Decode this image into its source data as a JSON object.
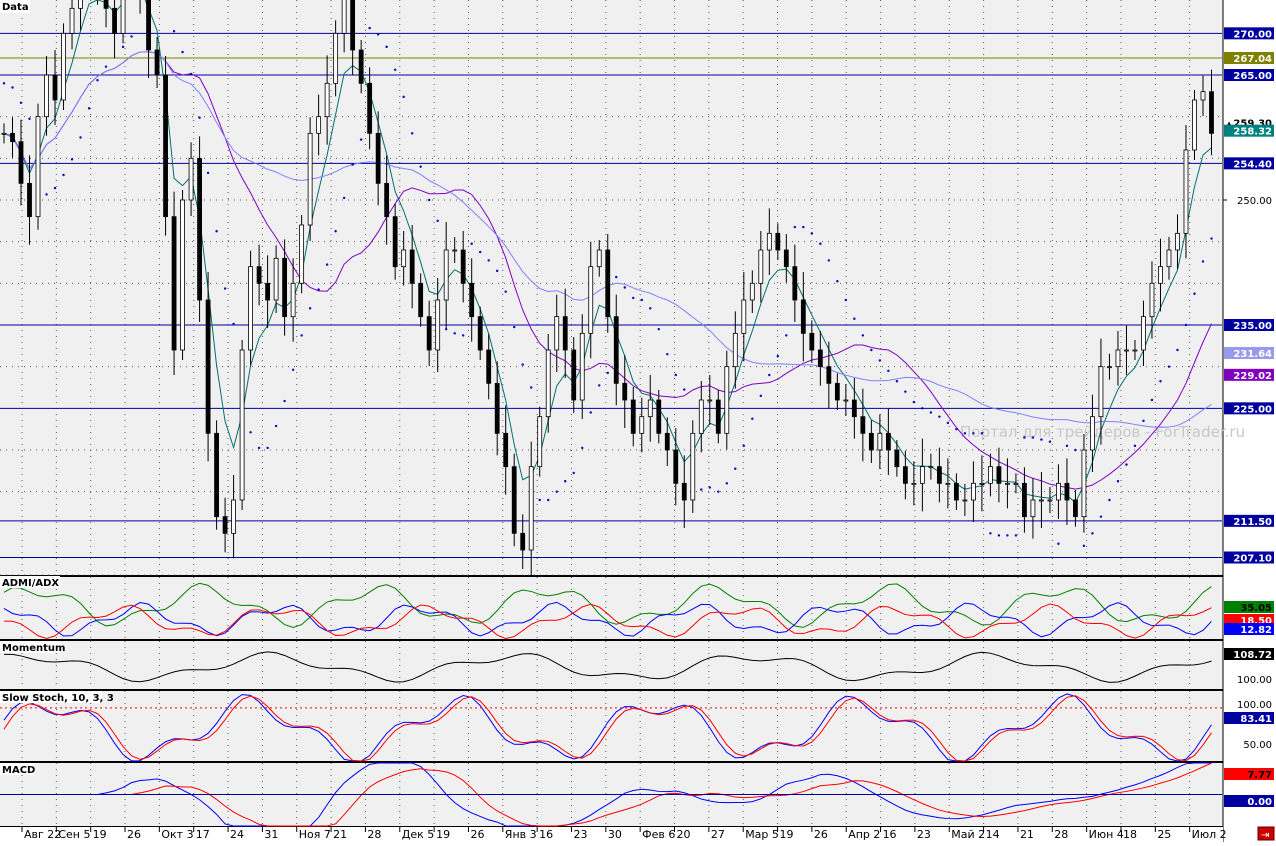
{
  "chart_data": [
    {
      "type": "candlestick",
      "panel": "Data",
      "title": "Data",
      "watermark": "Портал для трейдеров - ForTrader.ru",
      "ylim": [
        205,
        274
      ],
      "x_tick_labels": [
        "Авг 22",
        "Сен 5",
        "19",
        "26",
        "Окт 3",
        "17",
        "24",
        "31",
        "Ноя 7",
        "21",
        "28",
        "Дек 5",
        "19",
        "26",
        "Янв 3",
        "16",
        "23",
        "30",
        "Фев 6",
        "20",
        "27",
        "Мар 5",
        "19",
        "26",
        "Апр 2",
        "16",
        "23",
        "Май 2",
        "14",
        "21",
        "28",
        "Июн 4",
        "18",
        "25",
        "Июл 2"
      ],
      "y_ticks": [
        250
      ],
      "horizontal_lines": [
        {
          "value": 270.0,
          "label": "270.00",
          "color": "#0000a0"
        },
        {
          "value": 267.04,
          "label": "267.04",
          "color": "#808000"
        },
        {
          "value": 265.0,
          "label": "265.00",
          "color": "#0000a0"
        },
        {
          "value": 254.4,
          "label": "254.40",
          "color": "#0000a0"
        },
        {
          "value": 235.0,
          "label": "235.00",
          "color": "#0000a0"
        },
        {
          "value": 225.0,
          "label": "225.00",
          "color": "#0000a0"
        },
        {
          "value": 211.5,
          "label": "211.50",
          "color": "#0000a0"
        },
        {
          "value": 207.1,
          "label": "207.10",
          "color": "#0000a0"
        }
      ],
      "price_labels": [
        {
          "value": 259.3,
          "label": "259.30",
          "bg": "#ffffff",
          "fg": "#000000",
          "marker": "▲"
        },
        {
          "value": 258.32,
          "label": "258.32",
          "bg": "#008080",
          "fg": "#ffffff"
        },
        {
          "value": 231.64,
          "label": "231.64",
          "bg": "#9999ee",
          "fg": "#ffffff"
        },
        {
          "value": 229.02,
          "label": "229.02",
          "bg": "#8000c0",
          "fg": "#ffffff"
        }
      ],
      "closes": [
        258,
        257,
        252,
        248,
        260,
        265,
        262,
        270,
        273,
        278,
        280,
        275,
        273,
        270,
        276,
        280,
        275,
        268,
        265,
        248,
        232,
        250,
        255,
        238,
        222,
        212,
        210,
        214,
        232,
        242,
        240,
        238,
        243,
        236,
        240,
        247,
        258,
        260,
        264,
        270,
        275,
        268,
        264,
        258,
        252,
        248,
        242,
        244,
        240,
        236,
        232,
        238,
        244,
        244,
        240,
        236,
        232,
        228,
        222,
        218,
        210,
        208,
        218,
        224,
        232,
        236,
        232,
        226,
        234,
        242,
        244,
        236,
        228,
        226,
        222,
        224,
        226,
        222,
        220,
        216,
        214,
        222,
        226,
        226,
        222,
        230,
        234,
        238,
        240,
        244,
        246,
        244,
        242,
        238,
        234,
        232,
        230,
        228,
        226,
        226,
        224,
        222,
        220,
        222,
        220,
        218,
        216,
        216,
        218,
        218,
        216,
        216,
        214,
        214,
        216,
        216,
        218,
        216,
        216,
        216,
        212,
        214,
        214,
        214,
        216,
        214,
        212,
        220,
        224,
        230,
        230,
        232,
        232,
        232,
        236,
        240,
        242,
        244,
        246,
        256,
        262,
        263,
        258
      ],
      "series": [
        {
          "name": "EMA fast",
          "color": "#007070"
        },
        {
          "name": "MA mid",
          "color": "#8000c0"
        },
        {
          "name": "MA slow",
          "color": "#8080ff"
        },
        {
          "name": "Parabolic SAR",
          "color": "#0000c0"
        }
      ]
    },
    {
      "type": "line",
      "panel": "ADMI/ADX",
      "title": "ADMI/ADX",
      "series": [
        {
          "name": "ADX",
          "color": "#008000",
          "last_label": "35.05"
        },
        {
          "name": "+DI",
          "color": "#0000ff",
          "last_label": "12.82"
        },
        {
          "name": "-DI",
          "color": "#ff0000",
          "last_label": "18.50"
        }
      ]
    },
    {
      "type": "line",
      "panel": "Momentum",
      "title": "Momentum",
      "ticks": [
        "108.72",
        "100.00"
      ],
      "last_label": "108.72"
    },
    {
      "type": "line",
      "panel": "Slow Stoch",
      "title": "Slow Stoch, 10, 3, 3",
      "ticks": [
        "100.00",
        "83.41",
        "50.00"
      ],
      "last_label": "83.41",
      "series": [
        {
          "name": "%K",
          "color": "#0000ff"
        },
        {
          "name": "%D",
          "color": "#ff0000"
        }
      ]
    },
    {
      "type": "line",
      "panel": "MACD",
      "title": "MACD",
      "ticks": [
        "7.77",
        "0.00"
      ],
      "last_label": "7.77",
      "series": [
        {
          "name": "MACD",
          "color": "#0000ff"
        },
        {
          "name": "Signal",
          "color": "#ff0000"
        }
      ]
    }
  ],
  "colors": {
    "plot_bg": "#f0f0f0",
    "axis_bg": "#ffffff",
    "grid": "#555555",
    "hline": "#0000a0",
    "candle": "#000000"
  }
}
